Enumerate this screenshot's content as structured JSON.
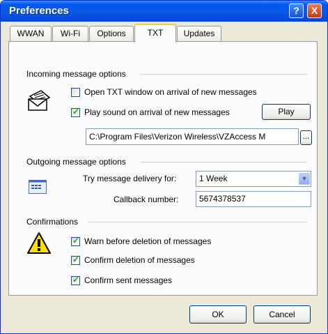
{
  "window": {
    "title": "Preferences",
    "help_label": "?",
    "close_label": "X"
  },
  "tabs": [
    {
      "label": "WWAN"
    },
    {
      "label": "Wi-Fi"
    },
    {
      "label": "Options"
    },
    {
      "label": "TXT"
    },
    {
      "label": "Updates"
    }
  ],
  "incoming": {
    "heading": "Incoming message options",
    "open_window_label": "Open TXT window on arrival of new messages",
    "open_window_checked": false,
    "play_sound_label": "Play sound on arrival of new messages",
    "play_sound_checked": true,
    "play_button": "Play",
    "sound_path": "C:\\Program Files\\Verizon Wireless\\VZAccess M",
    "browse_button": "..."
  },
  "outgoing": {
    "heading": "Outgoing message options",
    "delivery_label": "Try message delivery for:",
    "delivery_value": "1 Week",
    "callback_label": "Callback number:",
    "callback_value": "5674378537"
  },
  "confirmations": {
    "heading": "Confirmations",
    "items": [
      {
        "label": "Warn before deletion of messages",
        "checked": true
      },
      {
        "label": "Confirm deletion of messages",
        "checked": true
      },
      {
        "label": "Confirm sent messages",
        "checked": true
      }
    ]
  },
  "buttons": {
    "ok": "OK",
    "cancel": "Cancel"
  }
}
